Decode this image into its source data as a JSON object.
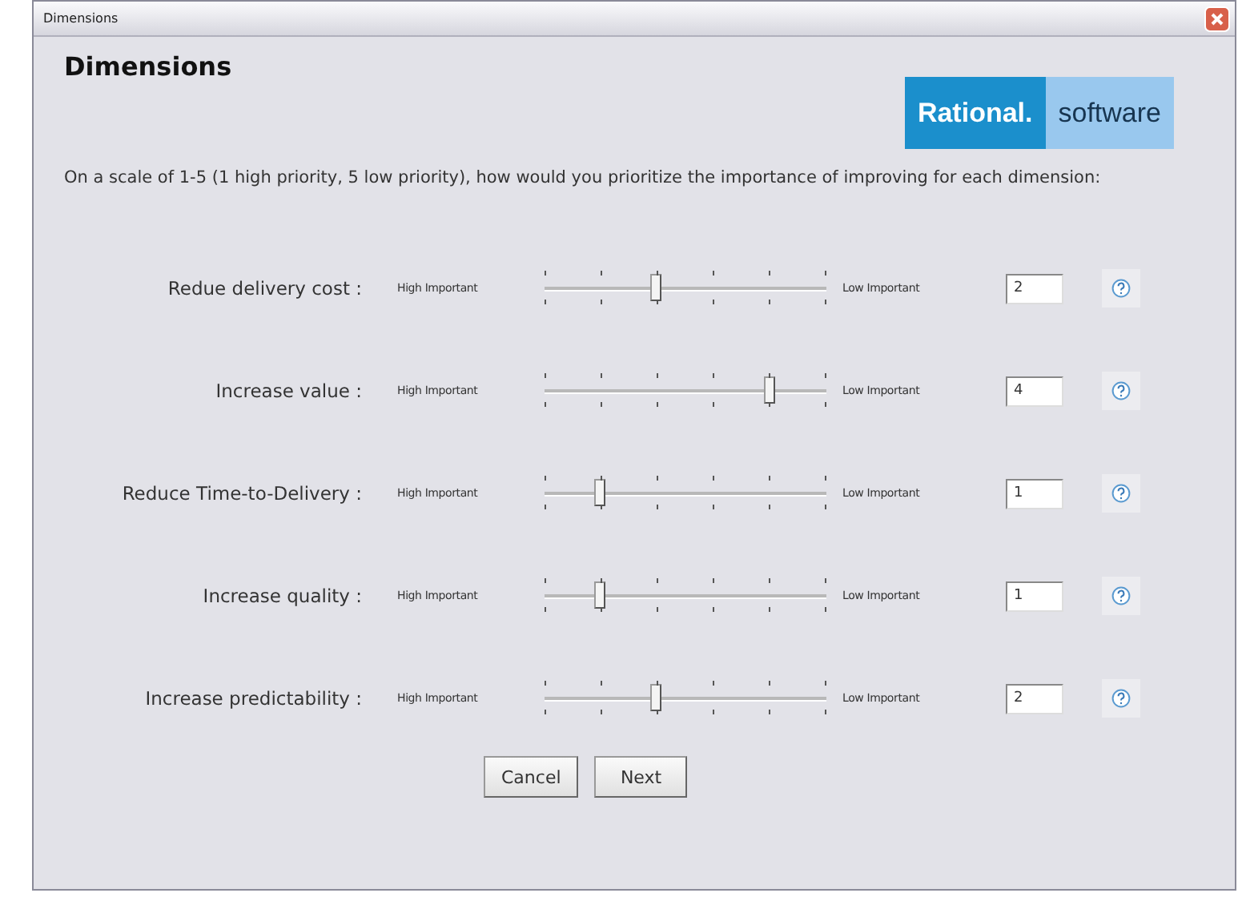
{
  "window": {
    "title": "Dimensions"
  },
  "heading": "Dimensions",
  "logo": {
    "primary": "Rational.",
    "secondary": "software"
  },
  "intro": "On a scale of 1-5 (1 high priority, 5 low priority), how would you prioritize the importance of improving for each dimension:",
  "rows": [
    {
      "label": "Redue delivery cost :",
      "low_end": "High Important",
      "high_end": "Low Important",
      "level": 0.4,
      "value": "2"
    },
    {
      "label": "Increase value :",
      "low_end": "High Important",
      "high_end": "Low Important",
      "level": 0.8,
      "value": "4"
    },
    {
      "label": "Reduce Time-to-Delivery :",
      "low_end": "High Important",
      "high_end": "Low Important",
      "level": 0.2,
      "value": "1"
    },
    {
      "label": "Increase quality :",
      "low_end": "High Important",
      "high_end": "Low Important",
      "level": 0.2,
      "value": "1"
    },
    {
      "label": "Increase predictability :",
      "low_end": "High Important",
      "high_end": "Low Important",
      "level": 0.4,
      "value": "2"
    }
  ],
  "buttons": [
    "Cancel",
    "Next"
  ]
}
